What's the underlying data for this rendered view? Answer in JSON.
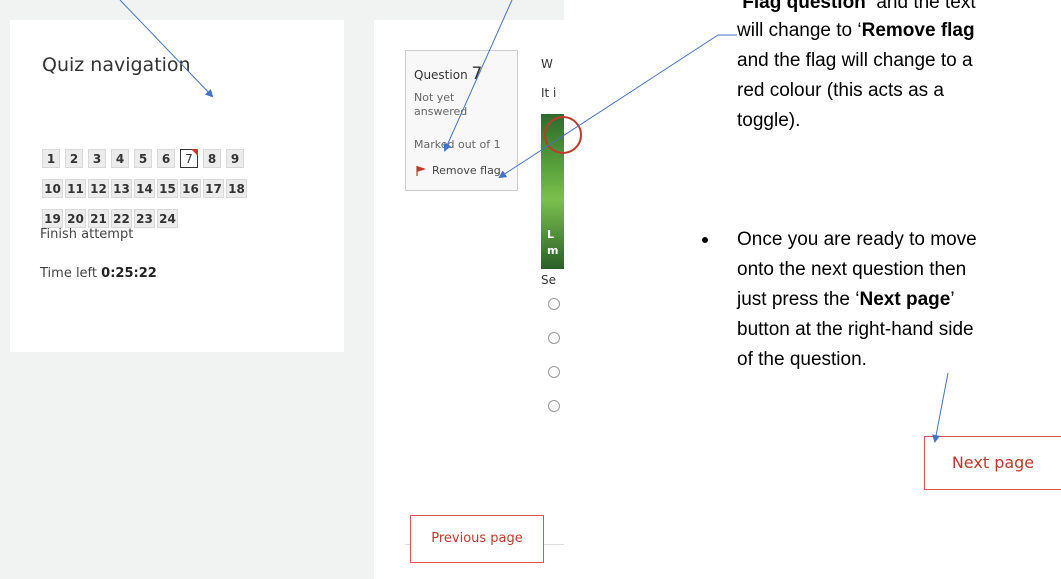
{
  "quiz_nav": {
    "title": "Quiz navigation",
    "questions": [
      "1",
      "2",
      "3",
      "4",
      "5",
      "6",
      "7",
      "8",
      "9",
      "10",
      "11",
      "12",
      "13",
      "14",
      "15",
      "16",
      "17",
      "18",
      "19",
      "20",
      "21",
      "22",
      "23",
      "24"
    ],
    "current_question": "7",
    "finish_attempt": "Finish attempt",
    "time_left_label": "Time left",
    "time_left_value": "0:25:22"
  },
  "question_info": {
    "label": "Question",
    "number": "7",
    "status": "Not yet answered",
    "marked": "Marked out of 1",
    "flag_action": "Remove flag",
    "flag_color": "#c0392b"
  },
  "question": {
    "text_line1": "W",
    "text_line2": "It i",
    "image_text_line1": "L",
    "image_text_line2": "m",
    "select_label": "Se"
  },
  "nav_buttons": {
    "previous": "Previous page",
    "next": "Next page"
  },
  "instructions": {
    "line1_suffix": "and the text",
    "line2_prefix": "will change to ‘",
    "line2_bold": "Remove flag",
    "line3": "and the flag will change to a",
    "line4": "red colour (this acts as a",
    "line5": "toggle).",
    "bullet_line1": "Once you are ready to move",
    "bullet_line2": "onto the next question then",
    "bullet_line3_prefix": "just press the ‘",
    "bullet_line3_bold": "Next page",
    "bullet_line3_suffix": "’",
    "bullet_line4": "button at the right-hand side",
    "bullet_line5": "of the question."
  },
  "colors": {
    "accent": "#c0392b",
    "arrow": "#4472c4",
    "panel_bg": "#f1f2f2"
  }
}
